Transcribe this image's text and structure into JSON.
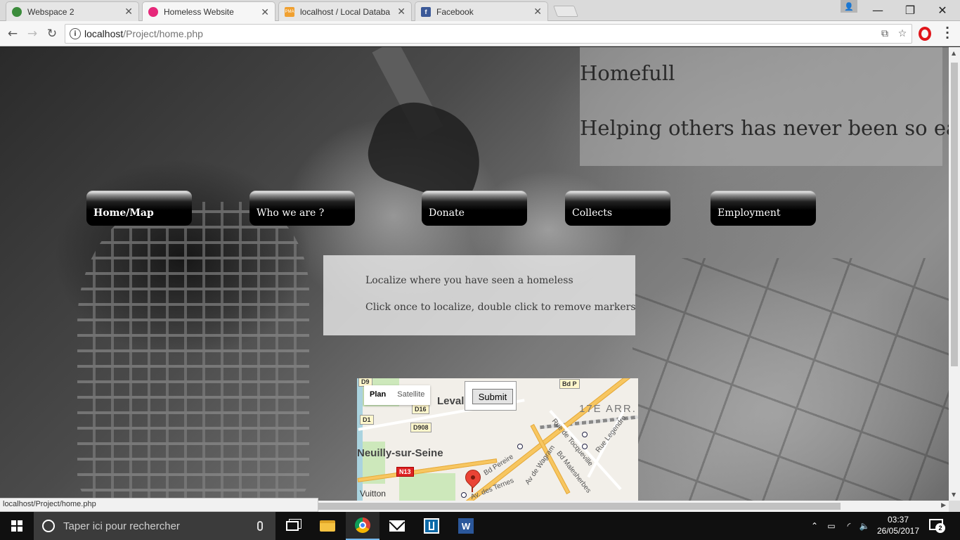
{
  "browser": {
    "tabs": [
      {
        "title": "Webspace 2",
        "favicon_color": "#3c8c3c"
      },
      {
        "title": "Homeless Website",
        "favicon_color": "#e6287a"
      },
      {
        "title": "localhost / Local Databa",
        "favicon_color": "#f0a030",
        "favicon_text": "PMA"
      },
      {
        "title": "Facebook",
        "favicon_color": "#3b5998",
        "favicon_text": "f"
      }
    ],
    "active_tab": 1,
    "url_host": "localhost",
    "url_path": "/Project/home.php",
    "status_url": "localhost/Project/home.php"
  },
  "site": {
    "title": "Homefull",
    "tagline": "Helping others has never been so easy",
    "nav": [
      {
        "label": "Home/Map",
        "active": true
      },
      {
        "label": "Who we are ?",
        "active": false
      },
      {
        "label": "Donate",
        "active": false
      },
      {
        "label": "Collects",
        "active": false
      },
      {
        "label": "Employment",
        "active": false
      }
    ],
    "instructions": {
      "line1": "Localize where you have seen a homeless",
      "line2": "Click once to localize, double click to remove markers"
    },
    "map": {
      "type_plan": "Plan",
      "type_satellite": "Satellite",
      "submit": "Submit",
      "labels": {
        "levallois": "Levallois",
        "neuilly": "Neuilly-sur-Seine",
        "arr": "17E ARR.",
        "vuitton": "Vuitton",
        "pereire": "Bd Pereire",
        "wagram": "Av de Wagram",
        "tocqueville": "Rue de Tocqueville",
        "malesherbes": "Bd Malesherbes",
        "legendre": "Rue Legendre",
        "ternes": "Av. des Ternes"
      },
      "shields": {
        "d9": "D9",
        "d16": "D16",
        "d1": "D1",
        "d908": "D908",
        "n13": "N13",
        "bdp": "Bd P"
      }
    }
  },
  "taskbar": {
    "search_placeholder": "Taper ici pour rechercher",
    "time": "03:37",
    "date": "26/05/2017",
    "notification_count": "2",
    "word_letter": "W"
  }
}
